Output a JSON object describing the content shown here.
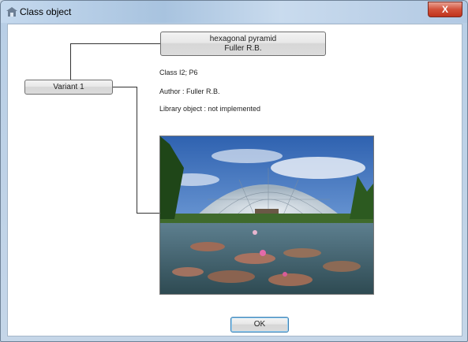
{
  "window": {
    "title": "Class object",
    "close_label": "X"
  },
  "class_button": {
    "line1": "hexagonal pyramid",
    "line2": "Fuller R.B."
  },
  "variant_button": {
    "label": "Variant 1"
  },
  "info": {
    "class_text": "Class I2; P6",
    "author_text": "Author : Fuller R.B.",
    "library_text": "Library object : not implemented"
  },
  "ok_button": {
    "label": "OK"
  },
  "colors": {
    "title_gradient": "#b9cfe6",
    "close_button": "#c9442c",
    "ok_focus": "#3c7fb1"
  },
  "icons": {
    "title": "window-app-icon",
    "photo": "geodesic-dome-photo"
  }
}
